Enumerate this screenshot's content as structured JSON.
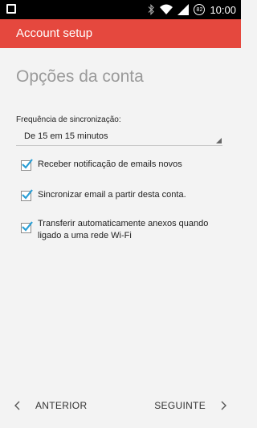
{
  "status_bar": {
    "time": "10:00",
    "battery_level": "82",
    "icons": [
      "notification-square-icon",
      "bluetooth-icon",
      "wifi-icon",
      "cell-signal-icon",
      "battery-icon"
    ]
  },
  "app_bar": {
    "title": "Account setup",
    "color": "#e5483e"
  },
  "page": {
    "title": "Opções da conta",
    "sync_frequency": {
      "label": "Frequência de sincronização:",
      "selected": "De 15 em 15 minutos"
    },
    "options": [
      {
        "label": "Receber notificação de emails novos",
        "checked": true
      },
      {
        "label": "Sincronizar email a partir desta conta.",
        "checked": true
      },
      {
        "label": "Transferir automaticamente anexos quando ligado a uma rede Wi-Fi",
        "checked": true
      }
    ]
  },
  "nav": {
    "previous_label": "ANTERIOR",
    "next_label": "SEGUINTE"
  },
  "colors": {
    "accent": "#e5483e",
    "checkmark": "#2a9fd6"
  }
}
